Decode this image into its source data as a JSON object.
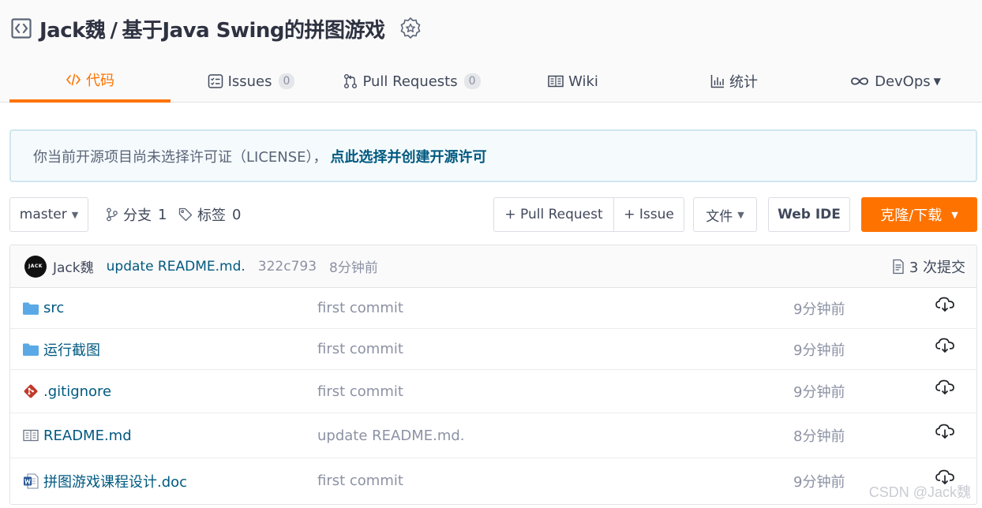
{
  "repo": {
    "owner": "Jack魏",
    "separator": "/",
    "name": "基于Java Swing的拼图游戏"
  },
  "tabs": [
    {
      "label": "代码",
      "icon": "code-icon",
      "active": true
    },
    {
      "label": "Issues",
      "count": "0",
      "icon": "issues-icon"
    },
    {
      "label": "Pull Requests",
      "count": "0",
      "icon": "pull-request-icon"
    },
    {
      "label": "Wiki",
      "icon": "book-icon"
    },
    {
      "label": "统计",
      "icon": "bar-chart-icon"
    },
    {
      "label": "DevOps",
      "icon": "infinity-icon"
    }
  ],
  "notice": {
    "text": "你当前开源项目尚未选择许可证（LICENSE），",
    "link": "点此选择并创建开源许可"
  },
  "toolbar": {
    "branch": "master",
    "branches_label": "分支",
    "branches_count": "1",
    "tags_label": "标签",
    "tags_count": "0",
    "pull_request": "+ Pull Request",
    "issue": "+ Issue",
    "file": "文件",
    "web_ide": "Web IDE",
    "clone": "克隆/下载"
  },
  "latest_commit": {
    "avatar_text": "JACK",
    "author": "Jack魏",
    "message": "update README.md.",
    "hash": "322c793",
    "time": "8分钟前",
    "count_label": "3 次提交"
  },
  "files": [
    {
      "name": "src",
      "type": "folder",
      "commit": "first commit",
      "time": "9分钟前"
    },
    {
      "name": "运行截图",
      "type": "folder",
      "commit": "first commit",
      "time": "9分钟前"
    },
    {
      "name": ".gitignore",
      "type": "git",
      "commit": "first commit",
      "time": "9分钟前"
    },
    {
      "name": "README.md",
      "type": "readme",
      "commit": "update README.md.",
      "time": "8分钟前"
    },
    {
      "name": "拼图游戏课程设计.doc",
      "type": "word",
      "commit": "first commit",
      "time": "9分钟前"
    }
  ],
  "watermark": "CSDN @Jack魏",
  "colors": {
    "accent": "#fe7300",
    "link": "#005980",
    "muted": "#8c92a4"
  }
}
